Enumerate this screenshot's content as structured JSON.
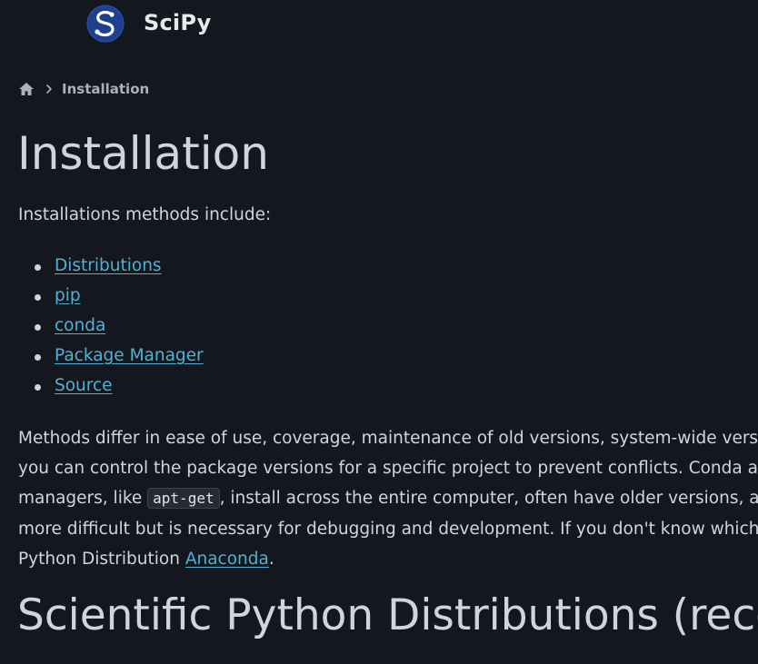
{
  "header": {
    "brand": "SciPy",
    "logo_icon": "scipy-logo-icon",
    "logo_color": "#1f3f8f"
  },
  "breadcrumb": {
    "home_icon": "home-icon",
    "separator_icon": "chevron-right-icon",
    "current": "Installation"
  },
  "main": {
    "title": "Installation",
    "intro": "Installations methods include:",
    "methods": [
      {
        "label": "Distributions"
      },
      {
        "label": "pip"
      },
      {
        "label": "conda"
      },
      {
        "label": "Package Manager"
      },
      {
        "label": "Source"
      }
    ],
    "paragraph": {
      "line1": "Methods differ in ease of use, coverage, maintenance of old versions, system-wide versus local",
      "line2": "you can control the package versions for a specific project to prevent conflicts. Conda also co",
      "line3_before": "managers, like ",
      "line3_code": "apt-get",
      "line3_after": ", install across the entire computer, often have older versions, and do",
      "line4": "more difficult but is necessary for debugging and development. If you don't know which inst",
      "line5_before": "Python Distribution ",
      "line5_link": "Anaconda",
      "line5_after": "."
    },
    "section_heading": "Scientific Python Distributions (recom"
  },
  "colors": {
    "background": "#14181e",
    "text": "#ced6dd",
    "link": "#4fb2d3"
  }
}
